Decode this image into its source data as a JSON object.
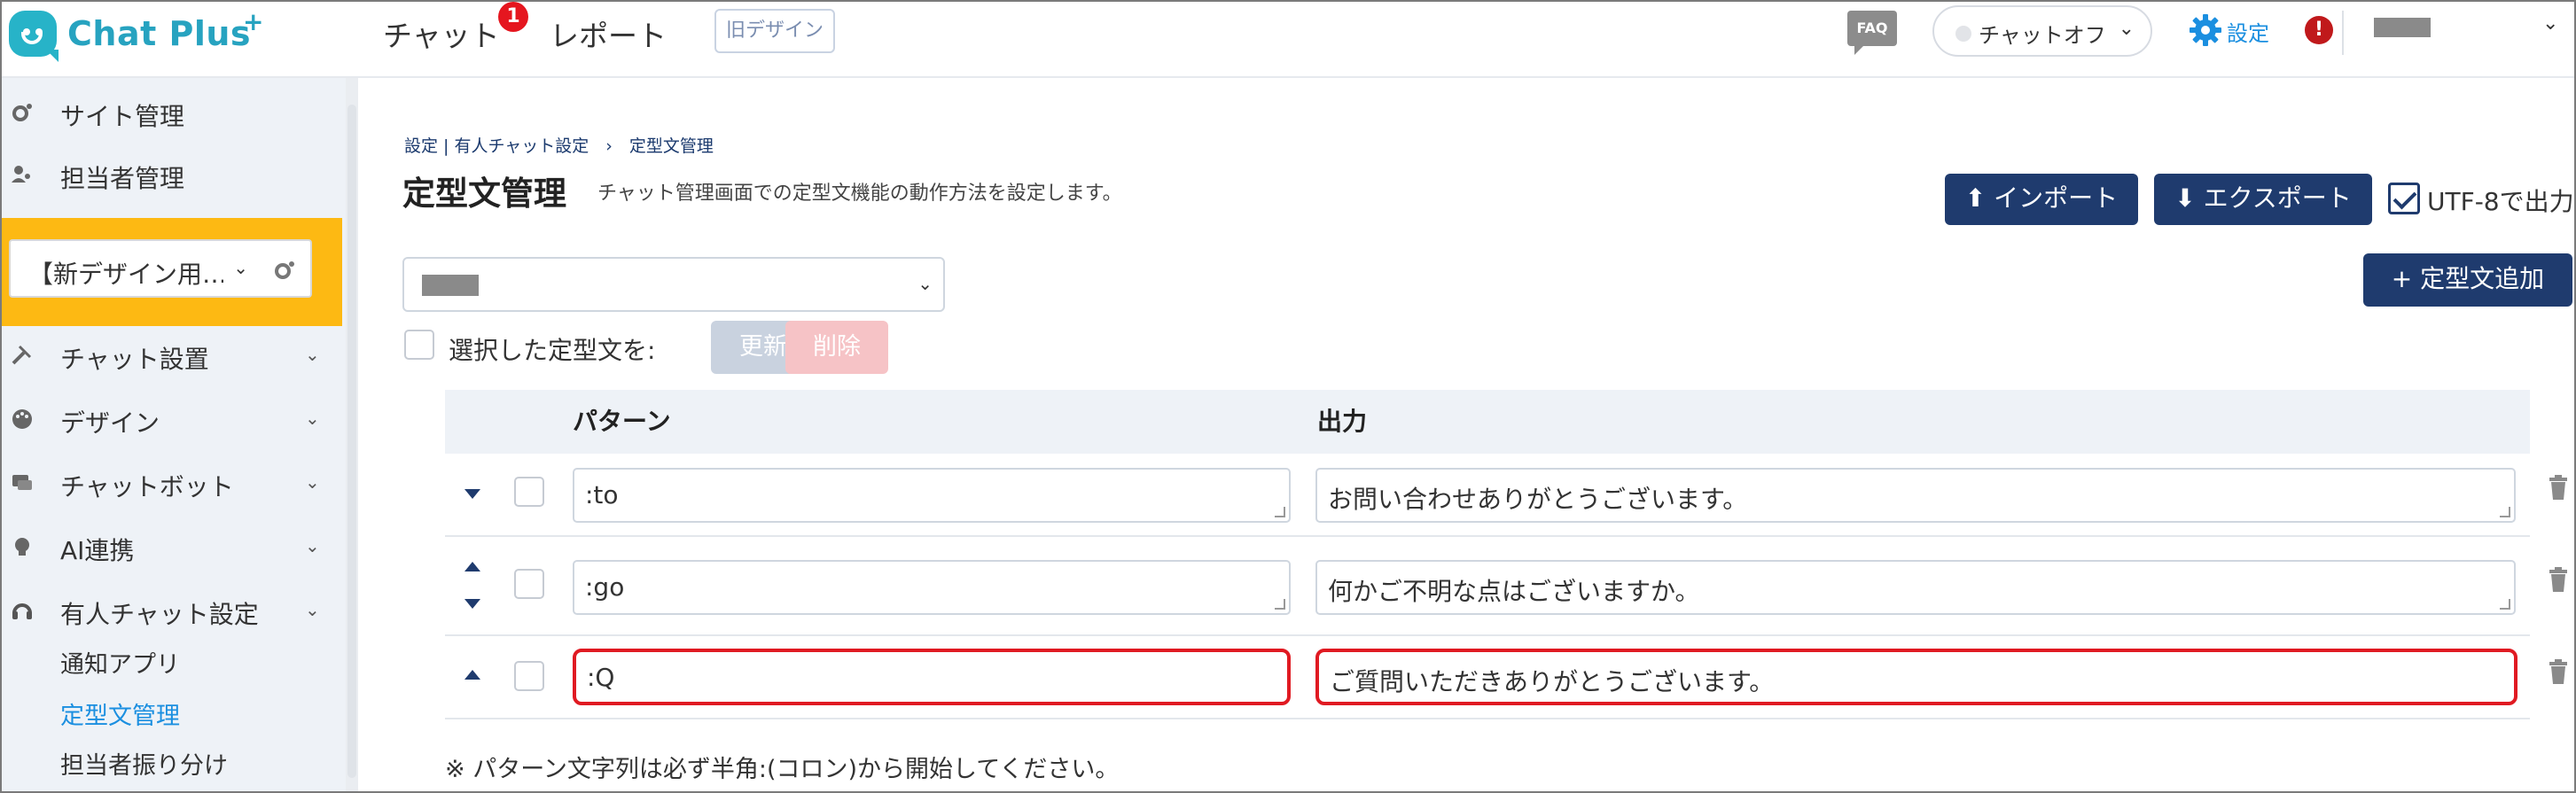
{
  "header": {
    "logo_text": "Chat Plus",
    "logo_plus": "+",
    "nav_chat": "チャット",
    "nav_chat_badge": "1",
    "nav_report": "レポート",
    "old_design": "旧デザイン",
    "faq": "FAQ",
    "chat_status": "チャットオフ",
    "settings": "設定",
    "alert": "!",
    "chevron": "⌄"
  },
  "sidebar": {
    "site_management": "サイト管理",
    "staff_management": "担当者管理",
    "site_select": "【新デザイン用…",
    "items": [
      {
        "label": "チャット設置"
      },
      {
        "label": "デザイン"
      },
      {
        "label": "チャットボット"
      },
      {
        "label": "AI連携"
      },
      {
        "label": "有人チャット設定"
      }
    ],
    "sub_items": [
      {
        "label": "通知アプリ"
      },
      {
        "label": "定型文管理"
      },
      {
        "label": "担当者振り分け"
      }
    ]
  },
  "main": {
    "breadcrumb": "設定 | 有人チャット設定　›　定型文管理",
    "title": "定型文管理",
    "description": "チャット管理画面での定型文機能の動作方法を設定します。",
    "import_label": "インポート",
    "export_label": "エクスポート",
    "utf8_label": "UTF-8で出力",
    "add_label": "定型文追加",
    "bulk_label": "選択した定型文を:",
    "update_label": "更新",
    "delete_label": "削除",
    "columns": {
      "pattern": "パターン",
      "output": "出力"
    },
    "rows": [
      {
        "pattern": ":to",
        "output": "お問い合わせありがとうございます。",
        "highlighted": false
      },
      {
        "pattern": ":go",
        "output": "何かご不明な点はございますか。",
        "highlighted": false
      },
      {
        "pattern": ":Q",
        "output": "ご質問いただきありがとうございます。",
        "highlighted": true
      }
    ],
    "footnote": "※ パターン文字列は必ず半角:(コロン)から開始してください。"
  },
  "colors": {
    "navy": "#1f3b6e",
    "accent_blue": "#1b8fe0",
    "highlight_red": "#e01a22",
    "sidebar_yellow": "#fdb913",
    "logo_teal": "#27a3c0"
  }
}
